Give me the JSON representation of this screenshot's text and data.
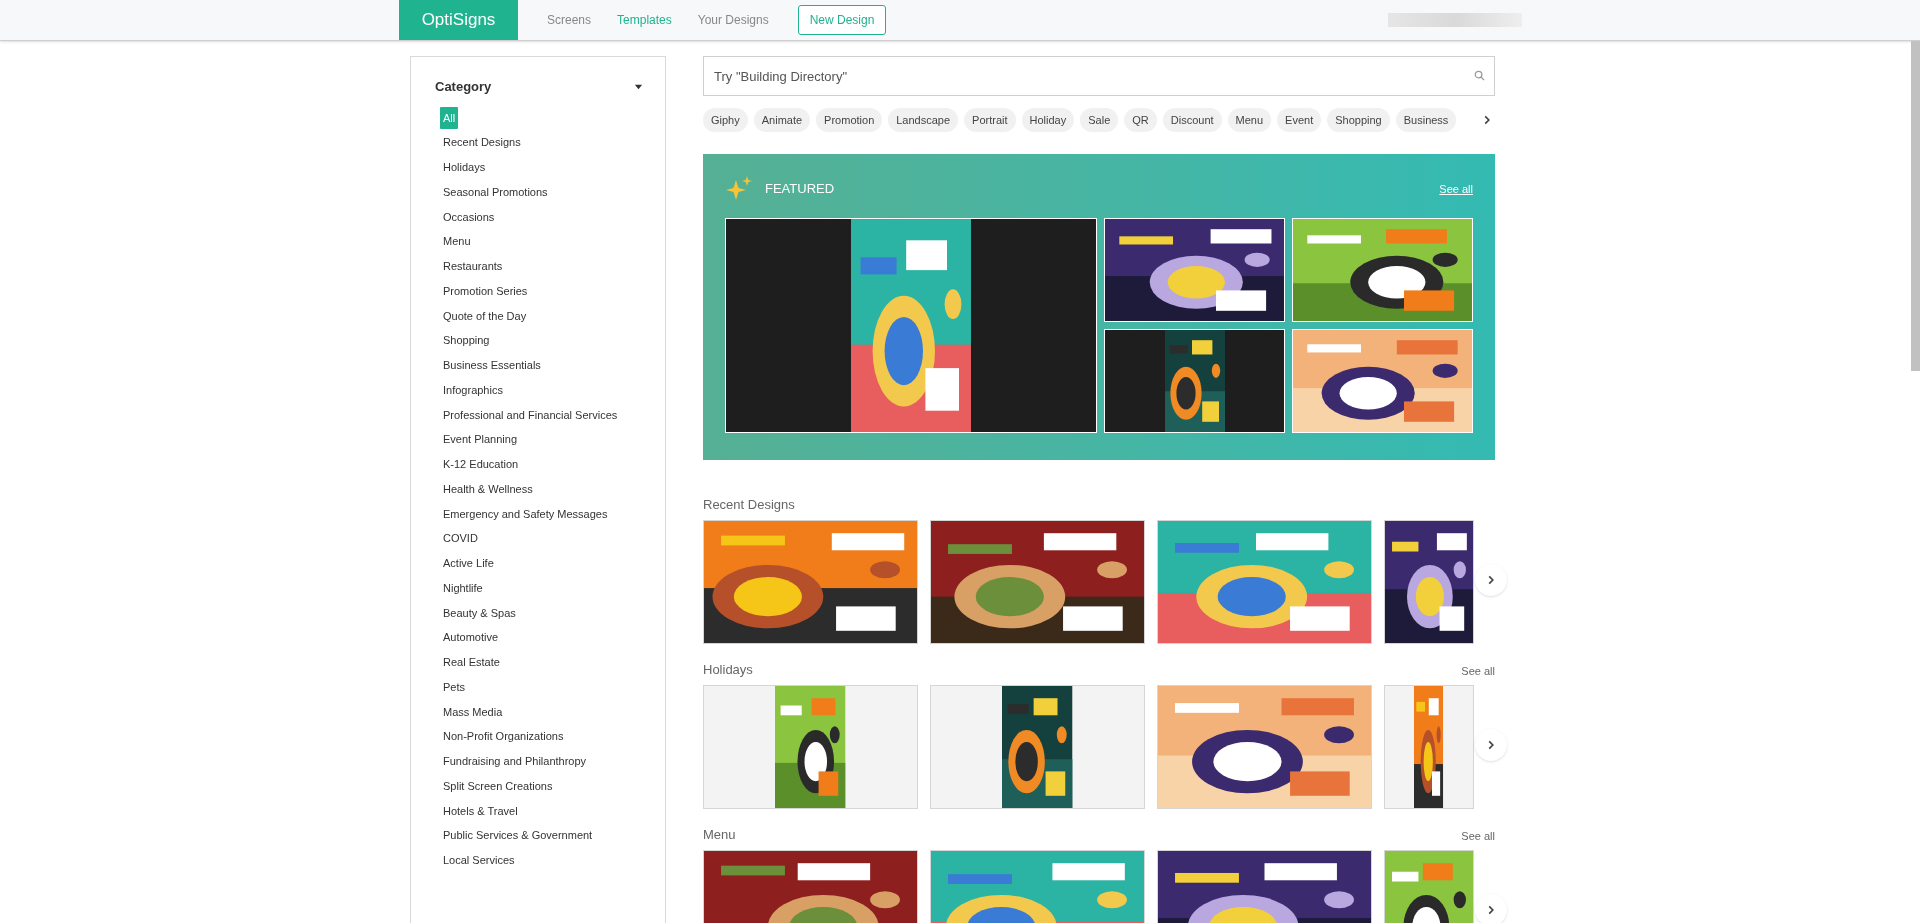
{
  "header": {
    "logo": "OptiSigns",
    "nav": [
      {
        "label": "Screens",
        "selected": false
      },
      {
        "label": "Templates",
        "selected": true
      },
      {
        "label": "Your Designs",
        "selected": false
      }
    ],
    "new_design": "New Design"
  },
  "sidebar": {
    "title": "Category",
    "expanded": true,
    "items": [
      {
        "label": "All",
        "selected": true
      },
      {
        "label": "Recent Designs",
        "selected": false
      },
      {
        "label": "Holidays",
        "selected": false
      },
      {
        "label": "Seasonal Promotions",
        "selected": false
      },
      {
        "label": "Occasions",
        "selected": false
      },
      {
        "label": "Menu",
        "selected": false
      },
      {
        "label": "Restaurants",
        "selected": false
      },
      {
        "label": "Promotion Series",
        "selected": false
      },
      {
        "label": "Quote of the Day",
        "selected": false
      },
      {
        "label": "Shopping",
        "selected": false
      },
      {
        "label": "Business Essentials",
        "selected": false
      },
      {
        "label": "Infographics",
        "selected": false
      },
      {
        "label": "Professional and Financial Services",
        "selected": false
      },
      {
        "label": "Event Planning",
        "selected": false
      },
      {
        "label": "K-12 Education",
        "selected": false
      },
      {
        "label": "Health & Wellness",
        "selected": false
      },
      {
        "label": "Emergency and Safety Messages",
        "selected": false
      },
      {
        "label": "COVID",
        "selected": false
      },
      {
        "label": "Active Life",
        "selected": false
      },
      {
        "label": "Nightlife",
        "selected": false
      },
      {
        "label": "Beauty & Spas",
        "selected": false
      },
      {
        "label": "Automotive",
        "selected": false
      },
      {
        "label": "Real Estate",
        "selected": false
      },
      {
        "label": "Pets",
        "selected": false
      },
      {
        "label": "Mass Media",
        "selected": false
      },
      {
        "label": "Non-Profit Organizations",
        "selected": false
      },
      {
        "label": "Fundraising and Philanthropy",
        "selected": false
      },
      {
        "label": "Split Screen Creations",
        "selected": false
      },
      {
        "label": "Hotels & Travel",
        "selected": false
      },
      {
        "label": "Public Services & Government",
        "selected": false
      },
      {
        "label": "Local Services",
        "selected": false
      }
    ]
  },
  "search": {
    "placeholder": "Try \"Building Directory\""
  },
  "tags": [
    "Giphy",
    "Animate",
    "Promotion",
    "Landscape",
    "Portrait",
    "Holiday",
    "Sale",
    "QR",
    "Discount",
    "Menu",
    "Event",
    "Shopping",
    "Business"
  ],
  "featured": {
    "title": "FEATURED",
    "see_all": "See all",
    "items": [
      {
        "kind": "portrait"
      },
      {
        "kind": "landscape"
      },
      {
        "kind": "landscape"
      },
      {
        "kind": "portrait"
      },
      {
        "kind": "landscape"
      }
    ]
  },
  "sections": [
    {
      "title": "Recent Designs",
      "items": [
        {
          "kind": "landscape"
        },
        {
          "kind": "landscape"
        },
        {
          "kind": "landscape"
        },
        {
          "kind": "landscape"
        }
      ]
    },
    {
      "title": "Holidays",
      "see_all": "See all",
      "items": [
        {
          "kind": "portrait"
        },
        {
          "kind": "portrait"
        },
        {
          "kind": "landscape"
        },
        {
          "kind": "portrait"
        }
      ]
    },
    {
      "title": "Menu",
      "see_all": "See all",
      "items": [
        {
          "kind": "landscape"
        },
        {
          "kind": "landscape"
        },
        {
          "kind": "landscape"
        },
        {
          "kind": "landscape"
        }
      ]
    }
  ]
}
